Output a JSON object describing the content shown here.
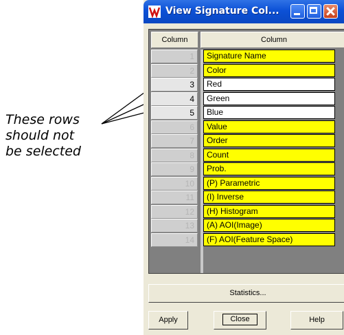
{
  "annotation": {
    "lines": [
      "These rows",
      "should not",
      "be selected"
    ]
  },
  "window": {
    "title": "View Signature Col...",
    "title_icon": "erdas-imagine-icon",
    "controls": [
      "minimize-icon",
      "maximize-icon",
      "close-icon"
    ]
  },
  "table": {
    "headers": {
      "column": "Column",
      "name": "Column"
    },
    "rows": [
      {
        "num": "1",
        "name": "Signature Name",
        "selected": true
      },
      {
        "num": "2",
        "name": "Color",
        "selected": true
      },
      {
        "num": "3",
        "name": "Red",
        "selected": false
      },
      {
        "num": "4",
        "name": "Green",
        "selected": false
      },
      {
        "num": "5",
        "name": "Blue",
        "selected": false
      },
      {
        "num": "6",
        "name": "Value",
        "selected": true
      },
      {
        "num": "7",
        "name": "Order",
        "selected": true
      },
      {
        "num": "8",
        "name": "Count",
        "selected": true
      },
      {
        "num": "9",
        "name": "Prob.",
        "selected": true
      },
      {
        "num": "10",
        "name": "(P) Parametric",
        "selected": true
      },
      {
        "num": "11",
        "name": "(I) Inverse",
        "selected": true
      },
      {
        "num": "12",
        "name": "(H) Histogram",
        "selected": true
      },
      {
        "num": "13",
        "name": "(A) AOI(Image)",
        "selected": true
      },
      {
        "num": "14",
        "name": "(F) AOI(Feature Space)",
        "selected": true
      }
    ]
  },
  "buttons": {
    "statistics": "Statistics...",
    "apply": "Apply",
    "close": "Close",
    "help": "Help"
  },
  "colors": {
    "selected_row": "#ffff00",
    "unselected_row": "#ffffff",
    "titlebar": "#0c51d6"
  }
}
